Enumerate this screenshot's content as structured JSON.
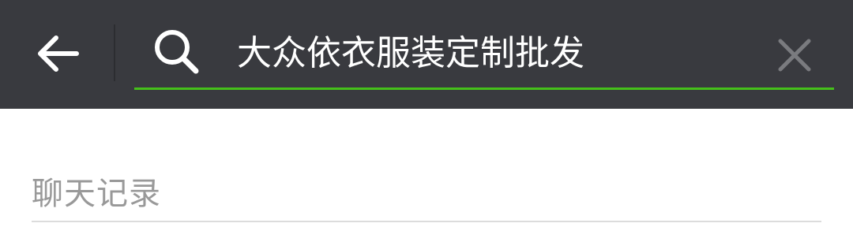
{
  "header": {
    "back_icon": "arrow-left-icon",
    "search_icon": "search-icon",
    "clear_icon": "close-icon",
    "search_value": "大众依衣服装定制批发",
    "accent_color": "#45c01a",
    "bar_color": "#393a3f"
  },
  "results": {
    "section_title": "聊天记录"
  }
}
